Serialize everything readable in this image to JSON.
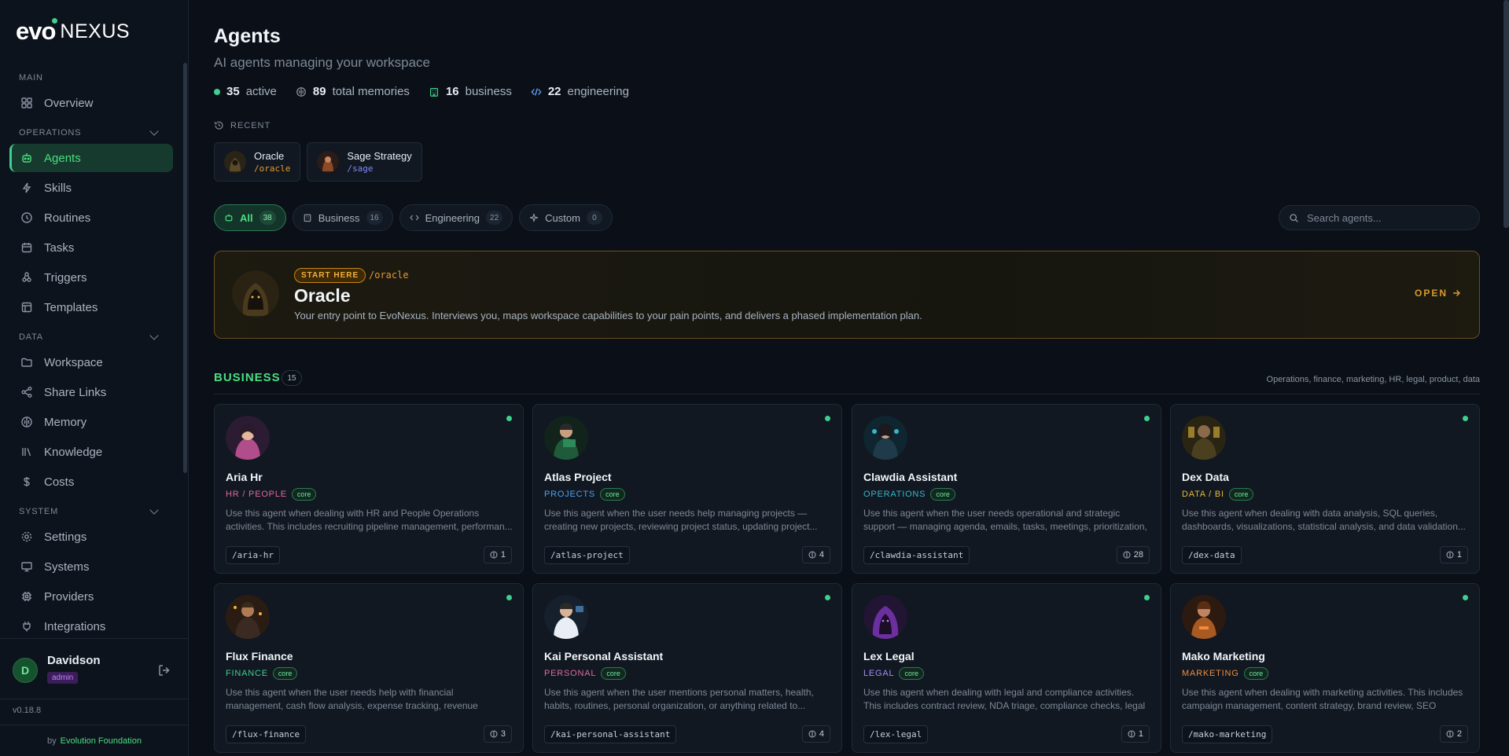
{
  "brand": {
    "evo": "evo",
    "nexus": "NEXUS"
  },
  "sidebar": {
    "sections": {
      "main": "MAIN",
      "operations": "OPERATIONS",
      "data": "DATA",
      "system": "SYSTEM"
    },
    "items": {
      "overview": "Overview",
      "agents": "Agents",
      "skills": "Skills",
      "routines": "Routines",
      "tasks": "Tasks",
      "triggers": "Triggers",
      "templates": "Templates",
      "workspace": "Workspace",
      "share_links": "Share Links",
      "memory": "Memory",
      "knowledge": "Knowledge",
      "costs": "Costs",
      "settings": "Settings",
      "systems": "Systems",
      "providers": "Providers",
      "integrations": "Integrations"
    },
    "user": {
      "initial": "D",
      "name": "Davidson",
      "role": "admin"
    },
    "version": "v0.18.8",
    "footer_by": "by",
    "footer_org": "Evolution Foundation"
  },
  "header": {
    "title": "Agents",
    "subtitle": "AI agents managing your workspace",
    "stats": {
      "active_count": "35",
      "active_label": "active",
      "memories_count": "89",
      "memories_label": "total memories",
      "business_count": "16",
      "business_label": "business",
      "engineering_count": "22",
      "engineering_label": "engineering"
    }
  },
  "recent": {
    "label": "RECENT",
    "items": [
      {
        "name": "Oracle",
        "slug": "/oracle"
      },
      {
        "name": "Sage Strategy",
        "slug": "/sage"
      }
    ]
  },
  "filters": [
    {
      "label": "All",
      "count": "38"
    },
    {
      "label": "Business",
      "count": "16"
    },
    {
      "label": "Engineering",
      "count": "22"
    },
    {
      "label": "Custom",
      "count": "0"
    }
  ],
  "search": {
    "placeholder": "Search agents..."
  },
  "hero": {
    "badge": "START HERE",
    "slug": "/oracle",
    "title": "Oracle",
    "description": "Your entry point to EvoNexus. Interviews you, maps workspace capabilities to your pain points, and delivers a phased implementation plan.",
    "open_label": "OPEN"
  },
  "business_section": {
    "title": "BUSINESS",
    "count": "15",
    "description": "Operations, finance, marketing, HR, legal, product, data"
  },
  "agents": [
    {
      "name": "Aria Hr",
      "category": "HR / PEOPLE",
      "cat_color": "#e2679b",
      "core": "core",
      "description": "Use this agent when dealing with HR and People Operations activities. This includes recruiting pipeline management, performan...",
      "slug": "/aria-hr",
      "memories": "1",
      "av_color": "#b14d8a"
    },
    {
      "name": "Atlas Project",
      "category": "PROJECTS",
      "cat_color": "#4ea1f3",
      "core": "core",
      "description": "Use this agent when the user needs help managing projects — creating new projects, reviewing project status, updating project...",
      "slug": "/atlas-project",
      "memories": "4",
      "av_color": "#2f8a5a"
    },
    {
      "name": "Clawdia Assistant",
      "category": "OPERATIONS",
      "cat_color": "#36b7c9",
      "core": "core",
      "description": "Use this agent when the user needs operational and strategic support — managing agenda, emails, tasks, meetings, prioritization, decisio...",
      "slug": "/clawdia-assistant",
      "memories": "28",
      "av_color": "#1f6c8a"
    },
    {
      "name": "Dex Data",
      "category": "DATA / BI",
      "cat_color": "#e6b93a",
      "core": "core",
      "description": "Use this agent when dealing with data analysis, SQL queries, dashboards, visualizations, statistical analysis, and data validation...",
      "slug": "/dex-data",
      "memories": "1",
      "av_color": "#8a6a1c"
    },
    {
      "name": "Flux Finance",
      "category": "FINANCE",
      "cat_color": "#3fcf8e",
      "core": "core",
      "description": "Use this agent when the user needs help with financial management, cash flow analysis, expense tracking, revenue monitoring, financial...",
      "slug": "/flux-finance",
      "memories": "3",
      "av_color": "#8a5a22"
    },
    {
      "name": "Kai Personal Assistant",
      "category": "PERSONAL",
      "cat_color": "#e2679b",
      "core": "core",
      "description": "Use this agent when the user mentions personal matters, health, habits, routines, personal organization, or anything related to...",
      "slug": "/kai-personal-assistant",
      "memories": "4",
      "av_color": "#3d6e9c"
    },
    {
      "name": "Lex Legal",
      "category": "LEGAL",
      "cat_color": "#a78bfa",
      "core": "core",
      "description": "Use this agent when dealing with legal and compliance activities. This includes contract review, NDA triage, compliance checks, legal risk...",
      "slug": "/lex-legal",
      "memories": "1",
      "av_color": "#6b2fa0"
    },
    {
      "name": "Mako Marketing",
      "category": "MARKETING",
      "cat_color": "#f08c3a",
      "core": "core",
      "description": "Use this agent when dealing with marketing activities. This includes campaign management, content strategy, brand review, SEO audits,...",
      "slug": "/mako-marketing",
      "memories": "2",
      "av_color": "#a85a22"
    }
  ],
  "colors": {
    "accent": "#3fcf8e",
    "background": "#0b1018",
    "card": "#111821",
    "hero_border": "#6b4e18",
    "gold": "#f5b13d"
  }
}
